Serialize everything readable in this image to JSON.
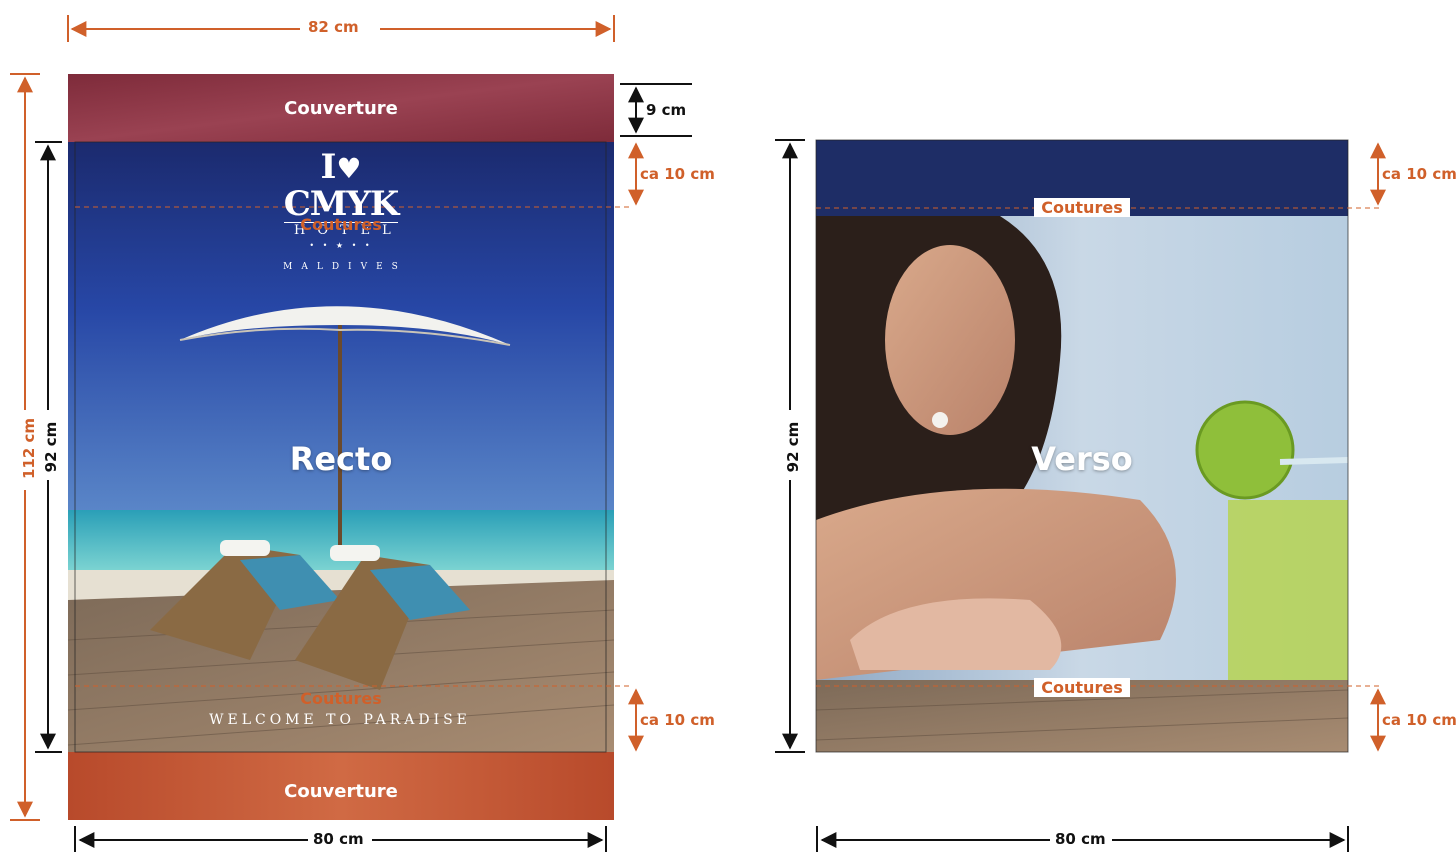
{
  "dimensions": {
    "top_width": "82 cm",
    "bottom_width_left": "80 cm",
    "bottom_width_right": "80 cm",
    "total_height": "112 cm",
    "recto_height": "92 cm",
    "verso_height": "92 cm",
    "cover_top_height": "9 cm",
    "recto_top_seam": "ca 10 cm",
    "recto_bottom_seam": "ca 10 cm",
    "verso_top_seam": "ca 10 cm",
    "verso_bottom_seam": "ca 10 cm"
  },
  "recto": {
    "cover_top_label": "Couverture",
    "cover_bottom_label": "Couverture",
    "label": "Recto",
    "seam_top_label": "Coutures",
    "seam_bottom_label": "Coutures",
    "logo": {
      "line1": "I",
      "line2": "CMYK",
      "line3": "HOTEL",
      "stars": "• • ★ • •",
      "line4": "MALDIVES"
    },
    "tagline": "WELCOME TO PARADISE"
  },
  "verso": {
    "label": "Verso",
    "seam_top_label": "Coutures",
    "seam_bottom_label": "Coutures"
  },
  "colors": {
    "accent": "#d0602a",
    "cover_top": "#8b3340",
    "cover_bottom": "#c4552f",
    "sky": "#1f3d8f",
    "sea": "#3fb6c4"
  }
}
